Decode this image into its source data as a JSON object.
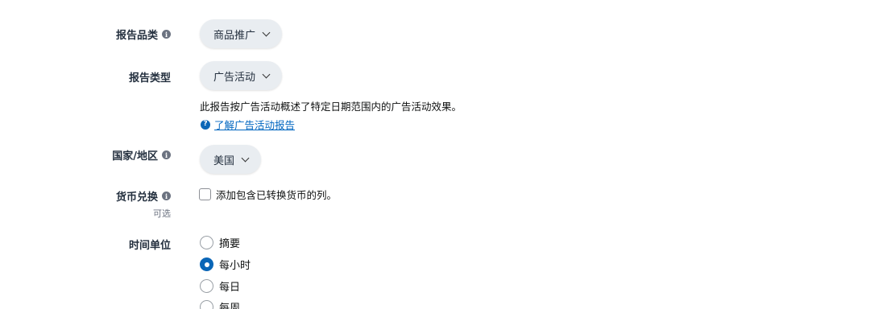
{
  "report_category": {
    "label": "报告品类",
    "value": "商品推广"
  },
  "report_type": {
    "label": "报告类型",
    "value": "广告活动",
    "description": "此报告按广告活动概述了特定日期范围内的广告活动效果。",
    "learn_more_link": "了解广告活动报告"
  },
  "country": {
    "label": "国家/地区",
    "value": "美国"
  },
  "currency": {
    "label": "货币兑换",
    "optional_label": "可选",
    "checkbox_label": "添加包含已转换货币的列。",
    "checked": false
  },
  "time_unit": {
    "label": "时间单位",
    "options": [
      {
        "label": "摘要",
        "selected": false
      },
      {
        "label": "每小时",
        "selected": true
      },
      {
        "label": "每日",
        "selected": false
      },
      {
        "label": "每周",
        "selected": false
      }
    ]
  },
  "colors": {
    "accent": "#0a66b7",
    "link": "#0066c0",
    "pill_bg": "#e9edf1"
  }
}
